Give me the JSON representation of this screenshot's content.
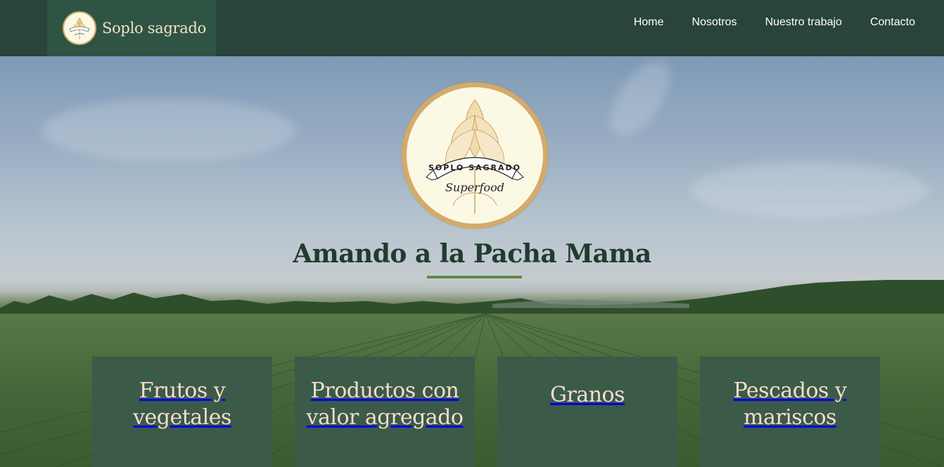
{
  "header": {
    "brand_name": "Soplo sagrado",
    "nav": [
      "Home",
      "Nosotros",
      "Nuestro trabajo",
      "Contacto"
    ]
  },
  "hero": {
    "logo_ribbon_text": "SOPLO SAGRADO",
    "logo_script_text": "Superfood",
    "title": "Amando a la Pacha Mama"
  },
  "cards": [
    {
      "label": "Frutos y vegetales"
    },
    {
      "label": "Productos con valor agregado"
    },
    {
      "label": "Granos"
    },
    {
      "label": "Pescados y mariscos"
    }
  ],
  "colors": {
    "header_bg": "#29443a",
    "brand_bg": "#2f5444",
    "card_bg": "#3c5a48",
    "card_text": "#f5dccd",
    "title_text": "#223b30",
    "underline": "#5f8a44",
    "logo_ring": "#d2ab6c"
  },
  "icons": [
    "brand-logo-icon",
    "hero-logo-icon"
  ]
}
